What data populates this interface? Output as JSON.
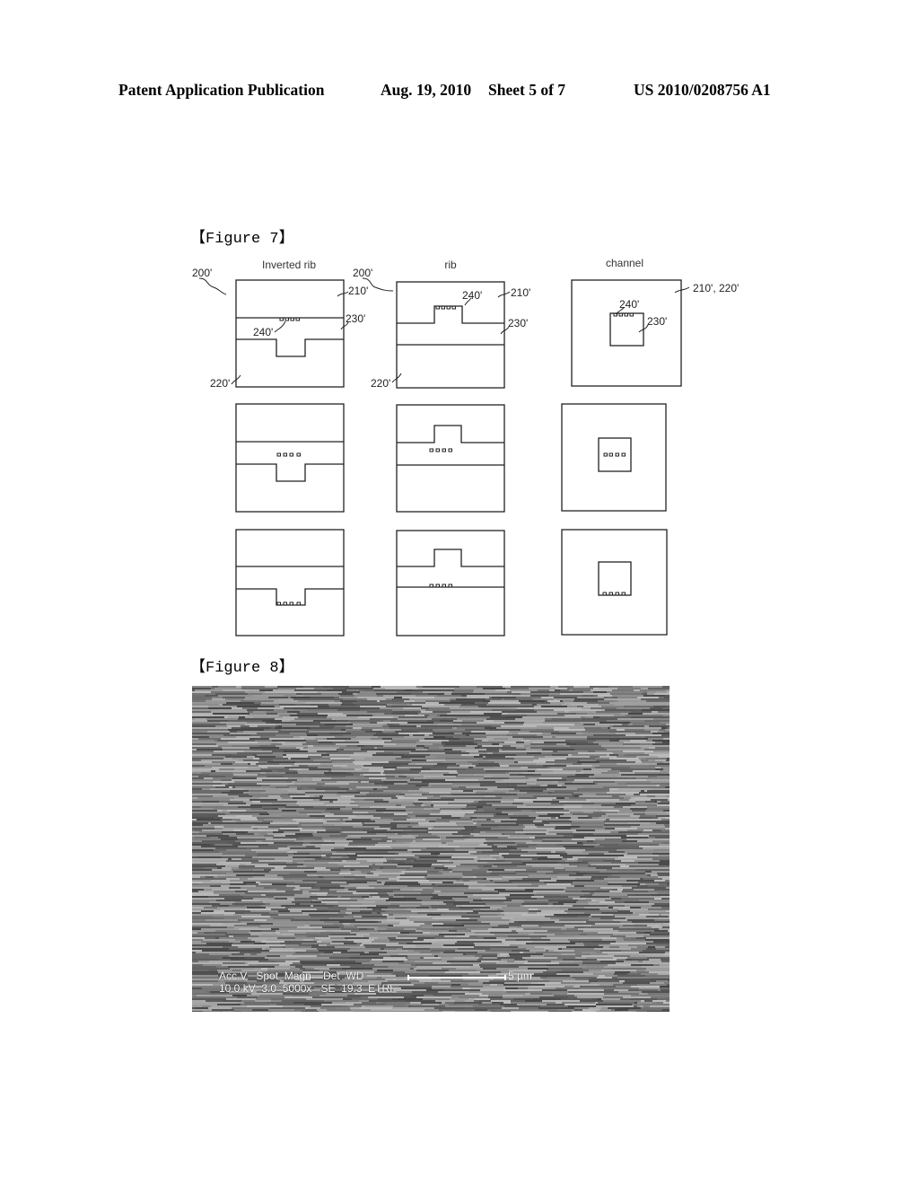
{
  "header": {
    "publication": "Patent Application Publication",
    "date": "Aug. 19, 2010",
    "sheet": "Sheet 5 of 7",
    "patent_number": "US 2010/0208756 A1"
  },
  "figure7": {
    "label": "【Figure 7】",
    "columns": [
      {
        "title": "Inverted rib",
        "ref_device": "200'",
        "ref_upper": "210'",
        "ref_core": "230'",
        "ref_grating": "240'",
        "ref_lower": "220'"
      },
      {
        "title": "rib",
        "ref_device": "200'",
        "ref_upper": "210'",
        "ref_core": "230'",
        "ref_grating": "240'",
        "ref_lower": "220'"
      },
      {
        "title": "channel",
        "ref_clad": "210', 220'",
        "ref_grating": "240'",
        "ref_core": "230'"
      }
    ],
    "rows": 3,
    "grating_positions": [
      "top-of-core",
      "middle-of-core",
      "bottom-of-core"
    ]
  },
  "figure8": {
    "label": "【Figure 8】",
    "sem": {
      "header_row": [
        "Acc.V",
        "Spot",
        "Magn",
        "Det",
        "WD"
      ],
      "value_row": [
        "10.0 kV",
        "3.0",
        "5000x",
        "SE",
        "19.3",
        "ETRI"
      ],
      "scale_bar_label": "5 µm"
    }
  }
}
